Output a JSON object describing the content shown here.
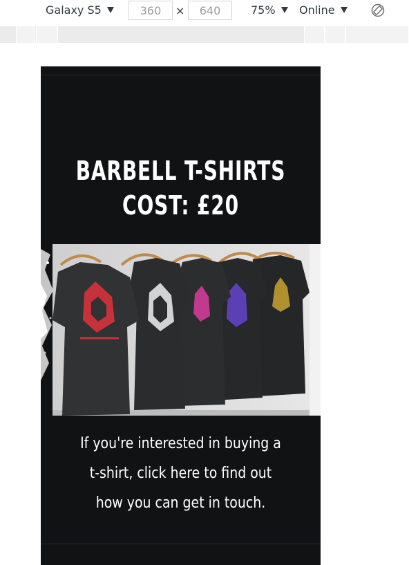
{
  "devtools": {
    "device_name": "Galaxy S5",
    "width_value": "360",
    "height_value": "640",
    "dimension_separator": "×",
    "zoom": "75%",
    "throttling": "Online",
    "icons": {
      "device_dropdown": "caret-down-icon",
      "zoom_dropdown": "caret-down-icon",
      "throttle_dropdown": "caret-down-icon",
      "rotate": "rotate-icon"
    }
  },
  "page": {
    "headline_line1": "BARBELL T-SHIRTS",
    "headline_line2": "COST: £20",
    "photo_alt": "Black Barbell t-shirts hanging on hangers",
    "body_text": "If you're interested in buying a t-shirt, click here to find out how you can get in touch."
  },
  "colors": {
    "page_background": "#111214",
    "text": "#ffffff",
    "toolbar_text": "#303942",
    "ruler": "#ebebeb"
  }
}
